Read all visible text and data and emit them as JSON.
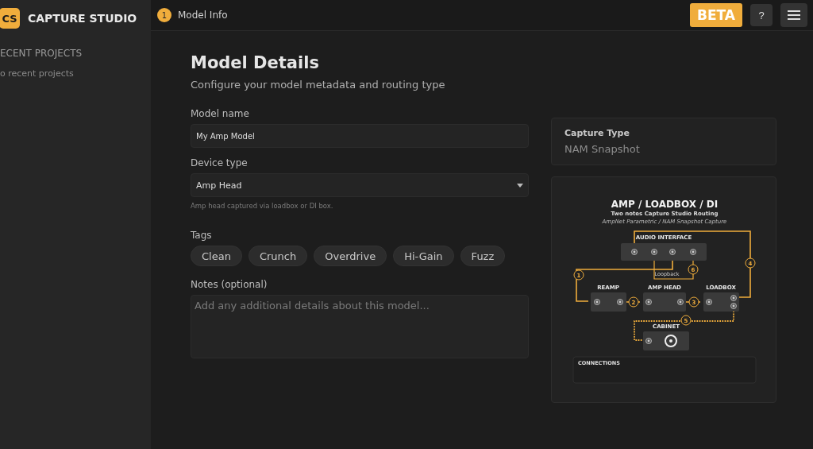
{
  "app": {
    "logo": "CS",
    "name": "CAPTURE STUDIO"
  },
  "sidebar": {
    "heading": "ECENT PROJECTS",
    "empty_text": "o recent projects"
  },
  "topbar": {
    "step": {
      "number": "1",
      "label": "Model Info"
    },
    "badge": "BETA",
    "help": "?"
  },
  "page": {
    "title": "Model Details",
    "subtitle": "Configure your model metadata and routing type"
  },
  "form": {
    "model_name": {
      "label": "Model name",
      "value": "My Amp Model"
    },
    "device_type": {
      "label": "Device type",
      "value": "Amp Head",
      "hint": "Amp head captured via loadbox or DI box."
    },
    "tags": {
      "label": "Tags",
      "items": [
        {
          "label": "Clean",
          "selected": false
        },
        {
          "label": "Crunch",
          "selected": false
        },
        {
          "label": "Overdrive",
          "selected": false
        },
        {
          "label": "Hi-Gain",
          "selected": false
        },
        {
          "label": "Fuzz",
          "selected": false
        }
      ]
    },
    "notes": {
      "label": "Notes (optional)",
      "placeholder": "Add any additional details about this model..."
    }
  },
  "capture_type": {
    "label": "Capture Type",
    "value": "NAM Snapshot"
  },
  "diagram": {
    "title": "AMP / LOADBOX / DI",
    "subtitle": "Two notes Capture Studio Routing",
    "caption": "AmpNet Parametric / NAM Snapshot Capture",
    "blocks": [
      "AUDIO INTERFACE",
      "REAMP",
      "AMP HEAD",
      "LOADBOX",
      "CABINET"
    ],
    "loopback": "Loopback",
    "connections_title": "CONNECTIONS",
    "connections": [
      {
        "number": "1"
      },
      {
        "number": "2"
      },
      {
        "number": "3"
      },
      {
        "number": "4"
      },
      {
        "number": "5"
      },
      {
        "number": "6"
      }
    ]
  }
}
